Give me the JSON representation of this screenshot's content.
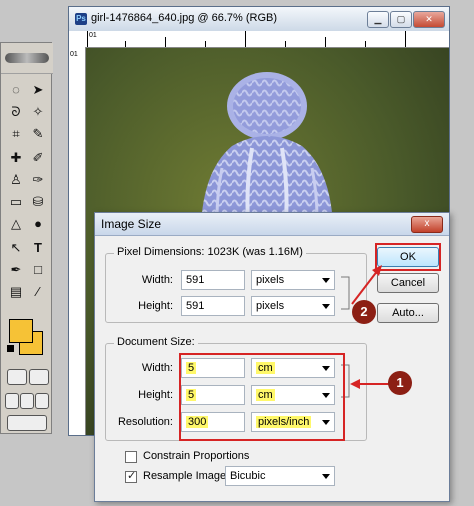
{
  "document_window": {
    "title": "girl-1476864_640.jpg @ 66.7% (RGB)",
    "ruler_numbers": [
      "01",
      "01"
    ]
  },
  "dialog": {
    "title": "Image Size",
    "close_label": "x",
    "pixel_dimensions": {
      "label": "Pixel Dimensions:",
      "size_text": "1023K (was 1.16M)",
      "width_label": "Width:",
      "width_value": "591",
      "width_unit": "pixels",
      "height_label": "Height:",
      "height_value": "591",
      "height_unit": "pixels"
    },
    "document_size": {
      "label": "Document Size:",
      "width_label": "Width:",
      "width_value": "5",
      "width_unit": "cm",
      "height_label": "Height:",
      "height_value": "5",
      "height_unit": "cm",
      "resolution_label": "Resolution:",
      "resolution_value": "300",
      "resolution_unit": "pixels/inch"
    },
    "buttons": {
      "ok": "OK",
      "cancel": "Cancel",
      "auto": "Auto..."
    },
    "constrain_proportions": {
      "label": "Constrain Proportions",
      "checked": false
    },
    "resample_image": {
      "label": "Resample Image:",
      "checked": true,
      "method": "Bicubic"
    }
  },
  "annotations": {
    "badge_1": "1",
    "badge_2": "2"
  },
  "colors": {
    "foreground": "#f6c236",
    "highlight": "#fff86a",
    "annotation_red": "#d62424",
    "badge": "#8c1f14"
  }
}
